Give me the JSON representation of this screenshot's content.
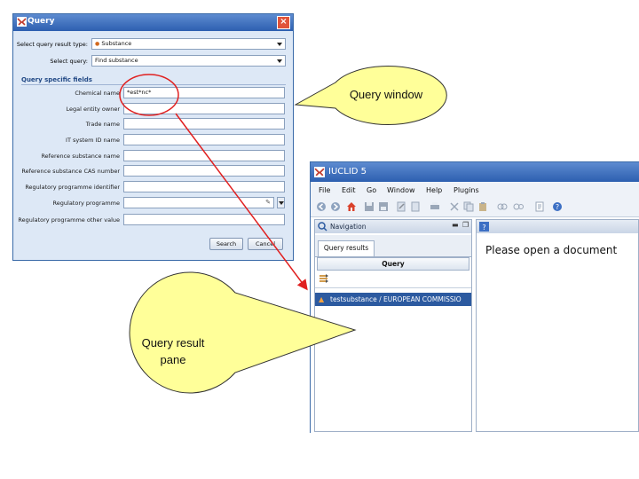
{
  "query_window": {
    "title": "Query",
    "result_type_label": "Select query result type:",
    "result_type_value": "Substance",
    "query_label": "Select query:",
    "query_value": "Find substance",
    "section_title": "Query specific fields",
    "fields": [
      {
        "label": "Chemical name",
        "value": "*est*nc*"
      },
      {
        "label": "Legal entity owner",
        "value": ""
      },
      {
        "label": "Trade name",
        "value": ""
      },
      {
        "label": "IT system ID name",
        "value": ""
      },
      {
        "label": "Reference substance name",
        "value": ""
      },
      {
        "label": "Reference substance CAS number",
        "value": ""
      },
      {
        "label": "Regulatory programme identifier",
        "value": ""
      },
      {
        "label": "Regulatory programme",
        "value": ""
      },
      {
        "label": "Regulatory programme other value",
        "value": ""
      }
    ],
    "search_button": "Search",
    "cancel_button": "Cancel"
  },
  "iuclid": {
    "title": "IUCLID 5",
    "menu": [
      "File",
      "Edit",
      "Go",
      "Window",
      "Help",
      "Plugins"
    ],
    "navigation_title": "Navigation",
    "tab_label": "Query results",
    "query_header": "Query",
    "result_item": "testsubstance / EUROPEAN COMMISSIO",
    "content_message": "Please open a document"
  },
  "callouts": {
    "query_window": "Query window",
    "query_result_line1": "Query result",
    "query_result_line2": "pane"
  },
  "colors": {
    "callout_fill": "#ffff99",
    "arrow": "#e02020",
    "highlight_circle": "#e02020",
    "titlebar": "#3a6cc0"
  }
}
